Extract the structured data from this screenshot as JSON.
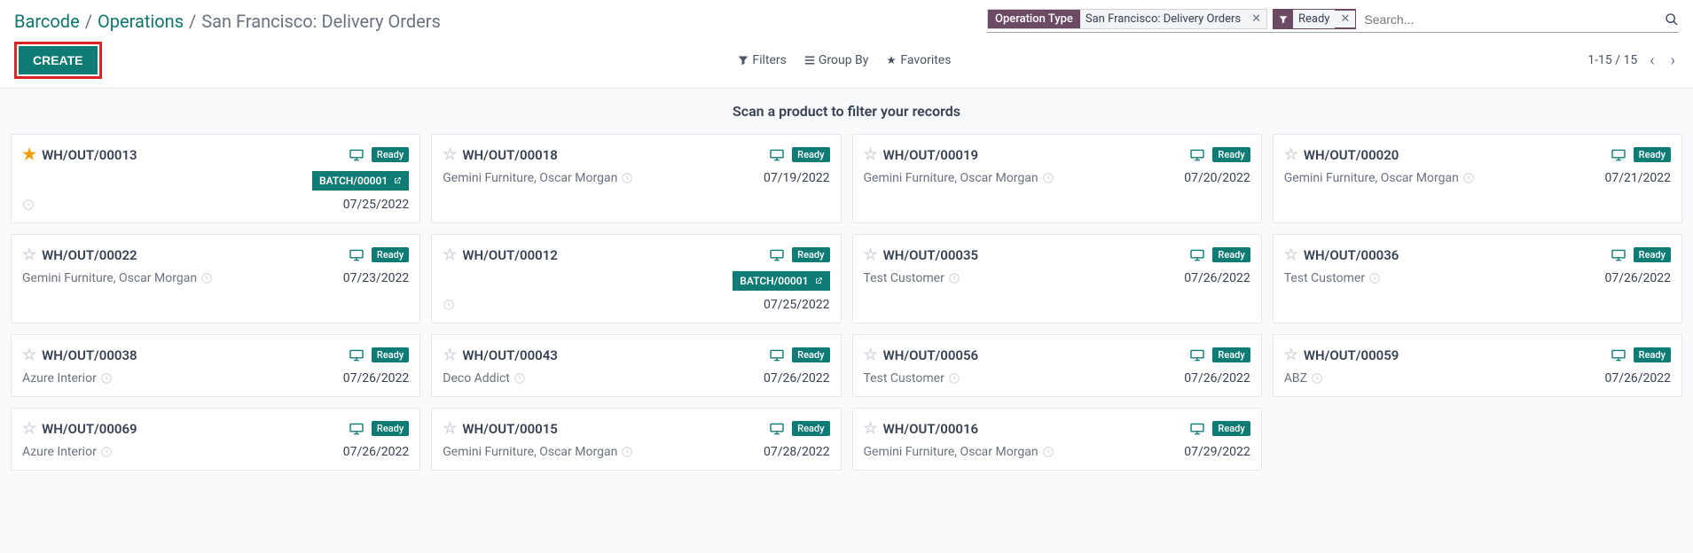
{
  "breadcrumb": {
    "root": "Barcode",
    "parent": "Operations",
    "current": "San Francisco: Delivery Orders"
  },
  "search": {
    "tag1_label": "Operation Type",
    "tag1_value": "San Francisco: Delivery Orders",
    "tag2_value": "Ready",
    "placeholder": "Search..."
  },
  "toolbar": {
    "filters": "Filters",
    "groupby": "Group By",
    "favorites": "Favorites"
  },
  "create": "CREATE",
  "pager": "1-15 / 15",
  "scan_prompt": "Scan a product to filter your records",
  "ready": "Ready",
  "cards": [
    {
      "ref": "WH/OUT/00013",
      "star": true,
      "batch": "BATCH/00001",
      "customer": "",
      "date": "07/25/2022"
    },
    {
      "ref": "WH/OUT/00018",
      "star": false,
      "customer": "Gemini Furniture, Oscar Morgan",
      "date": "07/19/2022"
    },
    {
      "ref": "WH/OUT/00019",
      "star": false,
      "customer": "Gemini Furniture, Oscar Morgan",
      "date": "07/20/2022"
    },
    {
      "ref": "WH/OUT/00020",
      "star": false,
      "customer": "Gemini Furniture, Oscar Morgan",
      "date": "07/21/2022"
    },
    {
      "ref": "WH/OUT/00022",
      "star": false,
      "customer": "Gemini Furniture, Oscar Morgan",
      "date": "07/23/2022"
    },
    {
      "ref": "WH/OUT/00012",
      "star": false,
      "batch": "BATCH/00001",
      "customer": "",
      "date": "07/25/2022"
    },
    {
      "ref": "WH/OUT/00035",
      "star": false,
      "customer": "Test Customer",
      "date": "07/26/2022"
    },
    {
      "ref": "WH/OUT/00036",
      "star": false,
      "customer": "Test Customer",
      "date": "07/26/2022"
    },
    {
      "ref": "WH/OUT/00038",
      "star": false,
      "customer": "Azure Interior",
      "date": "07/26/2022"
    },
    {
      "ref": "WH/OUT/00043",
      "star": false,
      "customer": "Deco Addict",
      "date": "07/26/2022"
    },
    {
      "ref": "WH/OUT/00056",
      "star": false,
      "customer": "Test Customer",
      "date": "07/26/2022"
    },
    {
      "ref": "WH/OUT/00059",
      "star": false,
      "customer": "ABZ",
      "date": "07/26/2022"
    },
    {
      "ref": "WH/OUT/00069",
      "star": false,
      "customer": "Azure Interior",
      "date": "07/26/2022"
    },
    {
      "ref": "WH/OUT/00015",
      "star": false,
      "customer": "Gemini Furniture, Oscar Morgan",
      "date": "07/28/2022"
    },
    {
      "ref": "WH/OUT/00016",
      "star": false,
      "customer": "Gemini Furniture, Oscar Morgan",
      "date": "07/29/2022"
    }
  ]
}
